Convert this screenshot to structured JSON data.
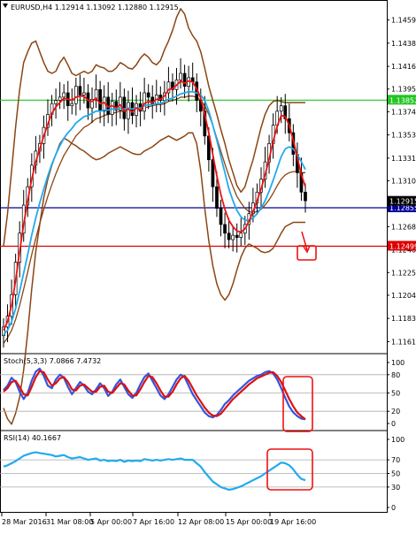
{
  "chart_data": [
    {
      "type": "candlestick",
      "symbol": "EURUSD,H4",
      "ohlc": [
        "1.12914",
        "1.13092",
        "1.12880",
        "1.12915"
      ],
      "y_ticks": [
        "1.14595",
        "1.14380",
        "1.14165",
        "1.13955",
        "1.13745",
        "1.13530",
        "1.13315",
        "1.13105",
        "1.12890",
        "1.12680",
        "1.12465",
        "1.12255",
        "1.12045",
        "1.11830",
        "1.11615"
      ],
      "ylim": [
        1.1152,
        1.1478
      ],
      "x_labels": [
        "28 Mar 2016",
        "31 Mar 08:00",
        "5 Apr 00:00",
        "7 Apr 16:00",
        "12 Apr 08:00",
        "15 Apr 00:00",
        "19 Apr 16:00"
      ],
      "levels": [
        {
          "value": 1.13852,
          "label": "1.13852",
          "color": "#22c422"
        },
        {
          "value": 1.12855,
          "label": "1.12855",
          "color": "#000099"
        },
        {
          "value": 1.12499,
          "label": "1.12499",
          "color": "#dd0000"
        }
      ],
      "last_price": {
        "value": 1.12915,
        "label": "1.12915"
      },
      "close": [
        1.1175,
        1.1185,
        1.1205,
        1.1235,
        1.1262,
        1.1288,
        1.1305,
        1.1325,
        1.1338,
        1.1345,
        1.136,
        1.1372,
        1.1382,
        1.1385,
        1.1388,
        1.1392,
        1.138,
        1.1382,
        1.1398,
        1.139,
        1.1392,
        1.1378,
        1.1386,
        1.1395,
        1.1375,
        1.1388,
        1.1372,
        1.1384,
        1.1376,
        1.1388,
        1.1368,
        1.1383,
        1.1371,
        1.1382,
        1.1375,
        1.1392,
        1.1388,
        1.1382,
        1.139,
        1.1385,
        1.1392,
        1.1402,
        1.1395,
        1.1404,
        1.141,
        1.1398,
        1.1406,
        1.1402,
        1.1385,
        1.1375,
        1.1352,
        1.133,
        1.1305,
        1.1285,
        1.127,
        1.1262,
        1.1256,
        1.126,
        1.1258,
        1.1262,
        1.127,
        1.128,
        1.129,
        1.13,
        1.1312,
        1.1328,
        1.1345,
        1.1362,
        1.1375,
        1.138,
        1.1368,
        1.1355,
        1.1335,
        1.1318,
        1.13,
        1.1292
      ],
      "sma_red": [
        1.1172,
        1.118,
        1.1195,
        1.1218,
        1.1245,
        1.127,
        1.1292,
        1.1312,
        1.1328,
        1.134,
        1.1352,
        1.1363,
        1.1373,
        1.1379,
        1.1383,
        1.1387,
        1.1386,
        1.1385,
        1.1388,
        1.1389,
        1.1389,
        1.1385,
        1.1384,
        1.1387,
        1.1382,
        1.1383,
        1.1379,
        1.138,
        1.1378,
        1.1381,
        1.1375,
        1.1377,
        1.1374,
        1.1378,
        1.1376,
        1.1382,
        1.1384,
        1.1383,
        1.1386,
        1.1386,
        1.1389,
        1.1395,
        1.1396,
        1.1399,
        1.1403,
        1.1401,
        1.1403,
        1.1402,
        1.1396,
        1.1387,
        1.1372,
        1.1355,
        1.1335,
        1.1315,
        1.1298,
        1.1284,
        1.1274,
        1.1268,
        1.1264,
        1.1263,
        1.1266,
        1.1273,
        1.1282,
        1.1292,
        1.1303,
        1.1316,
        1.1331,
        1.1347,
        1.1361,
        1.1371,
        1.137,
        1.1362,
        1.1348,
        1.1332,
        1.1316,
        1.1305
      ],
      "ema_blue": [
        1.1168,
        1.1172,
        1.118,
        1.1192,
        1.1208,
        1.1225,
        1.1242,
        1.126,
        1.1276,
        1.129,
        1.1303,
        1.1315,
        1.1326,
        1.1335,
        1.1343,
        1.135,
        1.1355,
        1.1359,
        1.1364,
        1.1367,
        1.137,
        1.1371,
        1.1373,
        1.1375,
        1.1375,
        1.1376,
        1.1376,
        1.1377,
        1.1377,
        1.1378,
        1.1377,
        1.1378,
        1.1377,
        1.1378,
        1.1378,
        1.138,
        1.1381,
        1.1381,
        1.1382,
        1.1382,
        1.1384,
        1.1386,
        1.1387,
        1.1389,
        1.1391,
        1.1392,
        1.1393,
        1.1393,
        1.1392,
        1.139,
        1.1385,
        1.1375,
        1.1362,
        1.1348,
        1.1333,
        1.1318,
        1.1303,
        1.1292,
        1.1283,
        1.1277,
        1.1274,
        1.1274,
        1.1276,
        1.128,
        1.1285,
        1.1292,
        1.1301,
        1.1311,
        1.1322,
        1.1333,
        1.134,
        1.1342,
        1.134,
        1.1335,
        1.1328,
        1.1321
      ],
      "sma_brown": [
        1.116,
        1.1165,
        1.1172,
        1.1182,
        1.1195,
        1.121,
        1.1226,
        1.1242,
        1.1257,
        1.1271,
        1.1284,
        1.1296,
        1.1307,
        1.1317,
        1.1326,
        1.1334,
        1.134,
        1.1346,
        1.1352,
        1.1356,
        1.136,
        1.1362,
        1.1365,
        1.1368,
        1.1369,
        1.1371,
        1.1372,
        1.1373,
        1.1374,
        1.1375,
        1.1375,
        1.1376,
        1.1376,
        1.1377,
        1.1377,
        1.1378,
        1.1379,
        1.138,
        1.1381,
        1.1381,
        1.1382,
        1.1384,
        1.1385,
        1.1386,
        1.1388,
        1.1388,
        1.1389,
        1.1389,
        1.1388,
        1.1385,
        1.138,
        1.1372,
        1.1362,
        1.135,
        1.1338,
        1.1326,
        1.1315,
        1.1305,
        1.1296,
        1.129,
        1.1285,
        1.1282,
        1.1281,
        1.1282,
        1.1284,
        1.1288,
        1.1293,
        1.1299,
        1.1306,
        1.1312,
        1.1316,
        1.1318,
        1.1319,
        1.1319,
        1.1318,
        1.1318
      ],
      "bb_upper": [
        1.125,
        1.128,
        1.132,
        1.136,
        1.1395,
        1.142,
        1.143,
        1.1438,
        1.144,
        1.143,
        1.142,
        1.1412,
        1.141,
        1.1412,
        1.142,
        1.1425,
        1.1418,
        1.141,
        1.1408,
        1.141,
        1.1412,
        1.141,
        1.1412,
        1.1418,
        1.1416,
        1.1415,
        1.1412,
        1.1412,
        1.1415,
        1.142,
        1.1418,
        1.1415,
        1.1414,
        1.1418,
        1.1424,
        1.1428,
        1.1425,
        1.142,
        1.1418,
        1.1422,
        1.1432,
        1.144,
        1.145,
        1.1462,
        1.147,
        1.1465,
        1.1452,
        1.1445,
        1.144,
        1.143,
        1.1415,
        1.1398,
        1.1385,
        1.1372,
        1.1358,
        1.1345,
        1.133,
        1.1318,
        1.1306,
        1.13,
        1.1305,
        1.1318,
        1.133,
        1.1345,
        1.136,
        1.1372,
        1.138,
        1.1384,
        1.1385,
        1.1384,
        1.1383,
        1.1383,
        1.1383,
        1.1383,
        1.1383,
        1.1383
      ],
      "bb_lower": [
        1.11,
        1.109,
        1.1085,
        1.1095,
        1.111,
        1.1135,
        1.117,
        1.121,
        1.1245,
        1.127,
        1.1295,
        1.1312,
        1.1325,
        1.1335,
        1.1345,
        1.135,
        1.1348,
        1.1345,
        1.1343,
        1.134,
        1.1338,
        1.1335,
        1.1332,
        1.133,
        1.1331,
        1.1333,
        1.1336,
        1.1338,
        1.134,
        1.1342,
        1.134,
        1.1338,
        1.1336,
        1.1335,
        1.1335,
        1.1338,
        1.134,
        1.1342,
        1.1345,
        1.1348,
        1.135,
        1.1352,
        1.135,
        1.1348,
        1.135,
        1.1352,
        1.1355,
        1.1355,
        1.1345,
        1.132,
        1.1285,
        1.1255,
        1.1232,
        1.1215,
        1.1205,
        1.12,
        1.1205,
        1.1215,
        1.1228,
        1.124,
        1.1248,
        1.1252,
        1.125,
        1.1248,
        1.1245,
        1.1244,
        1.1245,
        1.1248,
        1.1255,
        1.1262,
        1.1268,
        1.127,
        1.1272,
        1.1272,
        1.1272,
        1.1272
      ]
    },
    {
      "type": "line",
      "title": "Stoch(5,3,3) 7.0866 7.4732",
      "ylim": [
        0,
        100
      ],
      "y_ticks": [
        "100",
        "80",
        "50",
        "20",
        "0"
      ],
      "levels": [
        80,
        50,
        20
      ],
      "series": [
        {
          "color": "#3355dd",
          "values": [
            55,
            62,
            75,
            68,
            52,
            40,
            50,
            70,
            85,
            90,
            78,
            62,
            58,
            72,
            80,
            75,
            60,
            48,
            58,
            68,
            62,
            52,
            48,
            56,
            66,
            58,
            45,
            52,
            64,
            72,
            60,
            48,
            42,
            50,
            64,
            76,
            82,
            70,
            58,
            46,
            40,
            48,
            60,
            72,
            80,
            76,
            62,
            48,
            38,
            28,
            18,
            12,
            10,
            14,
            22,
            32,
            38,
            46,
            52,
            58,
            64,
            70,
            74,
            78,
            80,
            84,
            86,
            82,
            72,
            58,
            42,
            28,
            18,
            12,
            8,
            7
          ]
        },
        {
          "color": "#dd1111",
          "values": [
            52,
            58,
            68,
            70,
            60,
            48,
            46,
            60,
            76,
            86,
            84,
            72,
            62,
            66,
            74,
            76,
            68,
            56,
            54,
            62,
            64,
            58,
            52,
            52,
            60,
            62,
            52,
            50,
            58,
            66,
            64,
            54,
            46,
            46,
            56,
            68,
            78,
            76,
            66,
            54,
            44,
            44,
            52,
            64,
            74,
            78,
            70,
            58,
            46,
            36,
            26,
            18,
            13,
            12,
            16,
            24,
            32,
            40,
            46,
            52,
            58,
            64,
            69,
            74,
            77,
            80,
            83,
            84,
            78,
            68,
            54,
            40,
            28,
            18,
            12,
            7
          ]
        }
      ]
    },
    {
      "type": "line",
      "title": "RSI(14) 40.1667",
      "ylim": [
        0,
        100
      ],
      "y_ticks": [
        "100",
        "70",
        "50",
        "30",
        "0"
      ],
      "levels": [
        70,
        50,
        30
      ],
      "series": [
        {
          "color": "#22aaee",
          "values": [
            60,
            62,
            65,
            68,
            72,
            76,
            78,
            80,
            81,
            80,
            79,
            78,
            77,
            75,
            76,
            77,
            74,
            72,
            73,
            74,
            72,
            70,
            71,
            72,
            69,
            70,
            68,
            69,
            68,
            70,
            67,
            69,
            68,
            69,
            68,
            71,
            70,
            69,
            70,
            69,
            70,
            71,
            70,
            71,
            72,
            70,
            70,
            70,
            65,
            60,
            52,
            45,
            38,
            34,
            30,
            28,
            26,
            27,
            29,
            31,
            34,
            37,
            40,
            43,
            46,
            50,
            54,
            58,
            62,
            66,
            65,
            62,
            56,
            48,
            42,
            40
          ]
        }
      ]
    }
  ]
}
